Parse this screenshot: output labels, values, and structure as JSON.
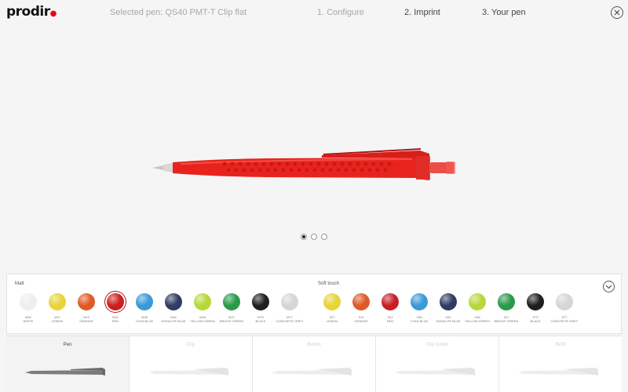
{
  "header": {
    "logo": "prodir",
    "selected_pen": "Selected pen: QS40 PMT-T Clip flat",
    "steps": [
      "1. Configure",
      "2. Imprint",
      "3. Your pen"
    ]
  },
  "colors": {
    "accent": "#e30613",
    "pen_body": "#e8231e"
  },
  "icons": {
    "close": "close-icon",
    "expand": "chevron-down-icon"
  },
  "carousel": {
    "count": 3,
    "active_index": 0
  },
  "palette": {
    "matt_label": "Matt",
    "soft_label": "Soft touch",
    "matt": [
      {
        "code": "M02",
        "name": "WHITE",
        "color": "#eeeeee"
      },
      {
        "code": "M07",
        "name": "LEMON",
        "color": "#e7d43a"
      },
      {
        "code": "M10",
        "name": "ORANGE",
        "color": "#e05a27"
      },
      {
        "code": "M21",
        "name": "RED",
        "color": "#cc1f1f"
      },
      {
        "code": "M38",
        "name": "CYAN BLUE",
        "color": "#3a9ad9"
      },
      {
        "code": "M42",
        "name": "SODALITE BLUE",
        "color": "#2f3d63"
      },
      {
        "code": "M48",
        "name": "YELLOW GREEN",
        "color": "#b7d83b"
      },
      {
        "code": "M47",
        "name": "BRIGHT GREEN",
        "color": "#2a9a4a"
      },
      {
        "code": "M75",
        "name": "BLACK",
        "color": "#1f1f1f"
      },
      {
        "code": "M77",
        "name": "CONCRETE GREY",
        "color": "#d6d6d6"
      }
    ],
    "soft": [
      {
        "code": "S07",
        "name": "LEMON",
        "color": "#e7d43a"
      },
      {
        "code": "S10",
        "name": "ORANGE",
        "color": "#e05a27"
      },
      {
        "code": "S21",
        "name": "RED",
        "color": "#c81f24"
      },
      {
        "code": "S38",
        "name": "CYAN BLUE",
        "color": "#3a9ad9"
      },
      {
        "code": "S42",
        "name": "SODALITE BLUE",
        "color": "#2f3d63"
      },
      {
        "code": "S48",
        "name": "YELLOW GREEN",
        "color": "#b7d83b"
      },
      {
        "code": "S47",
        "name": "BRIGHT GREEN",
        "color": "#2a9a4a"
      },
      {
        "code": "S75",
        "name": "BLACK",
        "color": "#1f1f1f"
      },
      {
        "code": "S77",
        "name": "CONCRETE GREY",
        "color": "#d6d6d6"
      }
    ],
    "selected": "M21"
  },
  "parts": [
    {
      "label": "Pen",
      "active": true
    },
    {
      "label": "Clip",
      "active": false
    },
    {
      "label": "Button",
      "active": false
    },
    {
      "label": "Clip holder",
      "active": false
    },
    {
      "label": "Refill",
      "active": false
    }
  ]
}
